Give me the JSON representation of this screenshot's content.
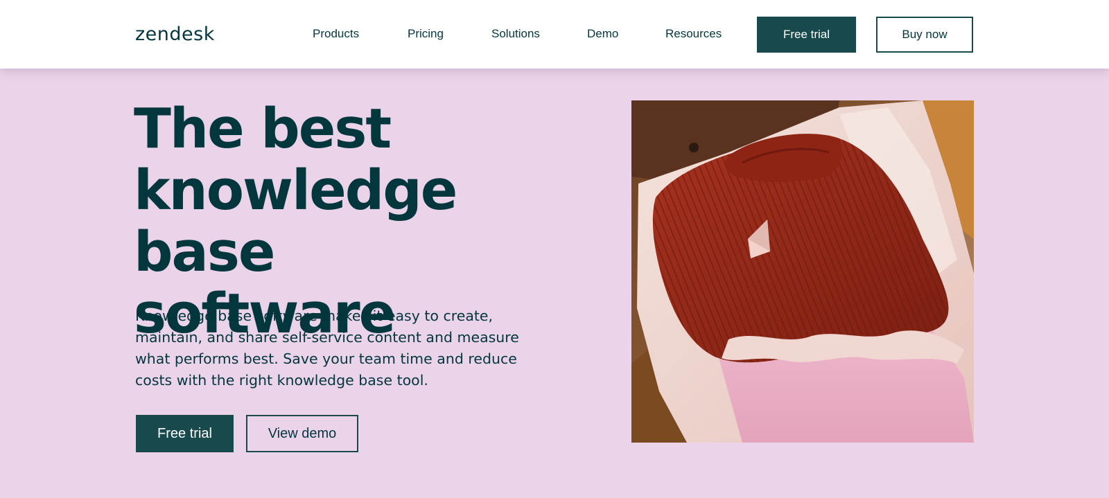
{
  "header": {
    "logo": "zendesk",
    "nav": [
      "Products",
      "Pricing",
      "Solutions",
      "Demo",
      "Resources"
    ],
    "free_trial_label": "Free trial",
    "buy_now_label": "Buy now"
  },
  "hero": {
    "title_lines": [
      "The best",
      "knowledge base",
      "software"
    ],
    "description": "Knowledge base software makes it easy to create, maintain, and share self-service content and measure what performs best. Save your team time and reduce costs with the right knowledge base tool.",
    "primary_label": "Free trial",
    "secondary_label": "View demo"
  },
  "colors": {
    "background": "#ebd4ea",
    "brand_dark": "#17494d",
    "text": "#03363d"
  }
}
